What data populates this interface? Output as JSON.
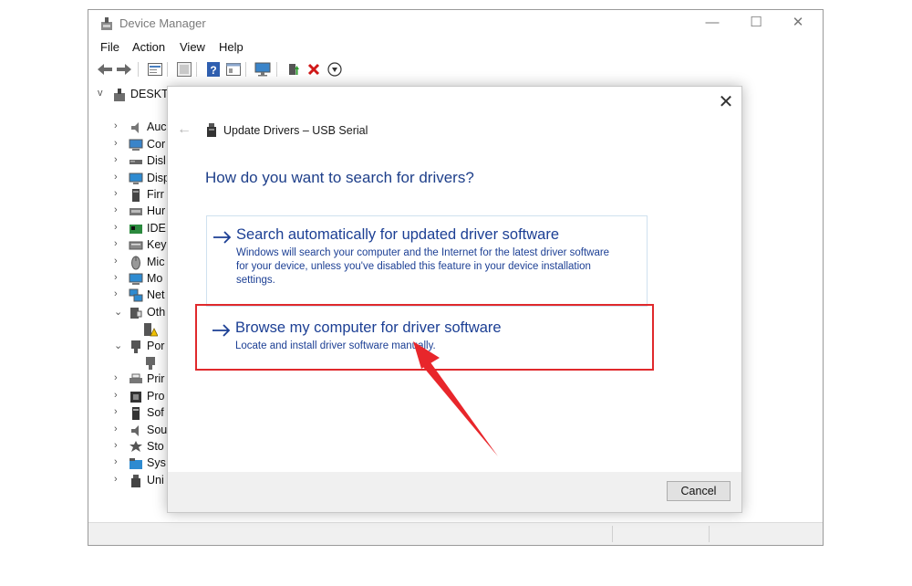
{
  "window": {
    "title": "Device Manager",
    "controls": {
      "minimize": "—",
      "maximize": "☐",
      "close": "✕"
    }
  },
  "menu": [
    "File",
    "Action",
    "View",
    "Help"
  ],
  "toolbar": [
    "back-icon",
    "forward-icon",
    "properties-icon",
    "scan-icon",
    "help-icon",
    "view-icon",
    "monitor-icon",
    "update-driver-icon",
    "uninstall-icon",
    "download-icon"
  ],
  "tree": {
    "root": "DESKTC",
    "items": [
      {
        "label": "Auc",
        "icon": "audio-icon",
        "expander": ">"
      },
      {
        "label": "Cor",
        "icon": "computer-icon",
        "expander": ">"
      },
      {
        "label": "Disl",
        "icon": "disk-icon",
        "expander": ">"
      },
      {
        "label": "Disp",
        "icon": "display-icon",
        "expander": ">"
      },
      {
        "label": "Firr",
        "icon": "firmware-icon",
        "expander": ">"
      },
      {
        "label": "Hur",
        "icon": "hid-icon",
        "expander": ">"
      },
      {
        "label": "IDE",
        "icon": "ide-icon",
        "expander": ">"
      },
      {
        "label": "Key",
        "icon": "keyboard-icon",
        "expander": ">"
      },
      {
        "label": "Mic",
        "icon": "mouse-icon",
        "expander": ">"
      },
      {
        "label": "Mo",
        "icon": "monitor-icon",
        "expander": ">"
      },
      {
        "label": "Net",
        "icon": "network-icon",
        "expander": ">"
      },
      {
        "label": "Oth",
        "icon": "other-devices-icon",
        "expander": "v"
      },
      {
        "label": "",
        "icon": "warning-device-icon",
        "expander": ""
      },
      {
        "label": "Por",
        "icon": "port-icon",
        "expander": "v"
      },
      {
        "label": "",
        "icon": "usb-port-icon",
        "expander": ""
      },
      {
        "label": "Prir",
        "icon": "printer-icon",
        "expander": ">"
      },
      {
        "label": "Pro",
        "icon": "processor-icon",
        "expander": ">"
      },
      {
        "label": "Sof",
        "icon": "software-icon",
        "expander": ">"
      },
      {
        "label": "Sou",
        "icon": "sound-icon",
        "expander": ">"
      },
      {
        "label": "Sto",
        "icon": "storage-icon",
        "expander": ">"
      },
      {
        "label": "Sys",
        "icon": "system-icon",
        "expander": ">"
      },
      {
        "label": "Uni",
        "icon": "usb-icon",
        "expander": ">"
      }
    ]
  },
  "dialog": {
    "title": "Update Drivers – USB Serial",
    "heading": "How do you want to search for drivers?",
    "option_auto": {
      "title": "Search automatically for updated driver software",
      "desc_line1": "Windows will search your computer and the Internet for the latest driver software",
      "desc_line2": "for your device, unless you've disabled this feature in your device installation",
      "desc_line3": "settings."
    },
    "option_browse": {
      "title": "Browse my computer for driver software",
      "desc": "Locate and install driver software manually."
    },
    "cancel_label": "Cancel",
    "close_glyph": "✕",
    "back_glyph": "←"
  },
  "colors": {
    "accent_text": "#1c3f94",
    "highlight_red": "#e0292c",
    "annotation_arrow": "#e8262b"
  }
}
